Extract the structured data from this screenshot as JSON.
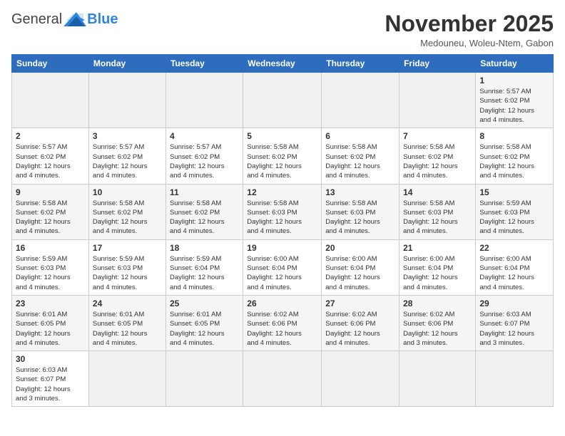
{
  "header": {
    "logo_general": "General",
    "logo_blue": "Blue",
    "month_title": "November 2025",
    "subtitle": "Medouneu, Woleu-Ntem, Gabon"
  },
  "days_of_week": [
    "Sunday",
    "Monday",
    "Tuesday",
    "Wednesday",
    "Thursday",
    "Friday",
    "Saturday"
  ],
  "weeks": [
    [
      {
        "day": "",
        "info": ""
      },
      {
        "day": "",
        "info": ""
      },
      {
        "day": "",
        "info": ""
      },
      {
        "day": "",
        "info": ""
      },
      {
        "day": "",
        "info": ""
      },
      {
        "day": "",
        "info": ""
      },
      {
        "day": "1",
        "info": "Sunrise: 5:57 AM\nSunset: 6:02 PM\nDaylight: 12 hours\nand 4 minutes."
      }
    ],
    [
      {
        "day": "2",
        "info": "Sunrise: 5:57 AM\nSunset: 6:02 PM\nDaylight: 12 hours\nand 4 minutes."
      },
      {
        "day": "3",
        "info": "Sunrise: 5:57 AM\nSunset: 6:02 PM\nDaylight: 12 hours\nand 4 minutes."
      },
      {
        "day": "4",
        "info": "Sunrise: 5:57 AM\nSunset: 6:02 PM\nDaylight: 12 hours\nand 4 minutes."
      },
      {
        "day": "5",
        "info": "Sunrise: 5:58 AM\nSunset: 6:02 PM\nDaylight: 12 hours\nand 4 minutes."
      },
      {
        "day": "6",
        "info": "Sunrise: 5:58 AM\nSunset: 6:02 PM\nDaylight: 12 hours\nand 4 minutes."
      },
      {
        "day": "7",
        "info": "Sunrise: 5:58 AM\nSunset: 6:02 PM\nDaylight: 12 hours\nand 4 minutes."
      },
      {
        "day": "8",
        "info": "Sunrise: 5:58 AM\nSunset: 6:02 PM\nDaylight: 12 hours\nand 4 minutes."
      }
    ],
    [
      {
        "day": "9",
        "info": "Sunrise: 5:58 AM\nSunset: 6:02 PM\nDaylight: 12 hours\nand 4 minutes."
      },
      {
        "day": "10",
        "info": "Sunrise: 5:58 AM\nSunset: 6:02 PM\nDaylight: 12 hours\nand 4 minutes."
      },
      {
        "day": "11",
        "info": "Sunrise: 5:58 AM\nSunset: 6:02 PM\nDaylight: 12 hours\nand 4 minutes."
      },
      {
        "day": "12",
        "info": "Sunrise: 5:58 AM\nSunset: 6:03 PM\nDaylight: 12 hours\nand 4 minutes."
      },
      {
        "day": "13",
        "info": "Sunrise: 5:58 AM\nSunset: 6:03 PM\nDaylight: 12 hours\nand 4 minutes."
      },
      {
        "day": "14",
        "info": "Sunrise: 5:58 AM\nSunset: 6:03 PM\nDaylight: 12 hours\nand 4 minutes."
      },
      {
        "day": "15",
        "info": "Sunrise: 5:59 AM\nSunset: 6:03 PM\nDaylight: 12 hours\nand 4 minutes."
      }
    ],
    [
      {
        "day": "16",
        "info": "Sunrise: 5:59 AM\nSunset: 6:03 PM\nDaylight: 12 hours\nand 4 minutes."
      },
      {
        "day": "17",
        "info": "Sunrise: 5:59 AM\nSunset: 6:03 PM\nDaylight: 12 hours\nand 4 minutes."
      },
      {
        "day": "18",
        "info": "Sunrise: 5:59 AM\nSunset: 6:04 PM\nDaylight: 12 hours\nand 4 minutes."
      },
      {
        "day": "19",
        "info": "Sunrise: 6:00 AM\nSunset: 6:04 PM\nDaylight: 12 hours\nand 4 minutes."
      },
      {
        "day": "20",
        "info": "Sunrise: 6:00 AM\nSunset: 6:04 PM\nDaylight: 12 hours\nand 4 minutes."
      },
      {
        "day": "21",
        "info": "Sunrise: 6:00 AM\nSunset: 6:04 PM\nDaylight: 12 hours\nand 4 minutes."
      },
      {
        "day": "22",
        "info": "Sunrise: 6:00 AM\nSunset: 6:04 PM\nDaylight: 12 hours\nand 4 minutes."
      }
    ],
    [
      {
        "day": "23",
        "info": "Sunrise: 6:01 AM\nSunset: 6:05 PM\nDaylight: 12 hours\nand 4 minutes."
      },
      {
        "day": "24",
        "info": "Sunrise: 6:01 AM\nSunset: 6:05 PM\nDaylight: 12 hours\nand 4 minutes."
      },
      {
        "day": "25",
        "info": "Sunrise: 6:01 AM\nSunset: 6:05 PM\nDaylight: 12 hours\nand 4 minutes."
      },
      {
        "day": "26",
        "info": "Sunrise: 6:02 AM\nSunset: 6:06 PM\nDaylight: 12 hours\nand 4 minutes."
      },
      {
        "day": "27",
        "info": "Sunrise: 6:02 AM\nSunset: 6:06 PM\nDaylight: 12 hours\nand 4 minutes."
      },
      {
        "day": "28",
        "info": "Sunrise: 6:02 AM\nSunset: 6:06 PM\nDaylight: 12 hours\nand 3 minutes."
      },
      {
        "day": "29",
        "info": "Sunrise: 6:03 AM\nSunset: 6:07 PM\nDaylight: 12 hours\nand 3 minutes."
      }
    ],
    [
      {
        "day": "30",
        "info": "Sunrise: 6:03 AM\nSunset: 6:07 PM\nDaylight: 12 hours\nand 3 minutes."
      },
      {
        "day": "",
        "info": ""
      },
      {
        "day": "",
        "info": ""
      },
      {
        "day": "",
        "info": ""
      },
      {
        "day": "",
        "info": ""
      },
      {
        "day": "",
        "info": ""
      },
      {
        "day": "",
        "info": ""
      }
    ]
  ]
}
